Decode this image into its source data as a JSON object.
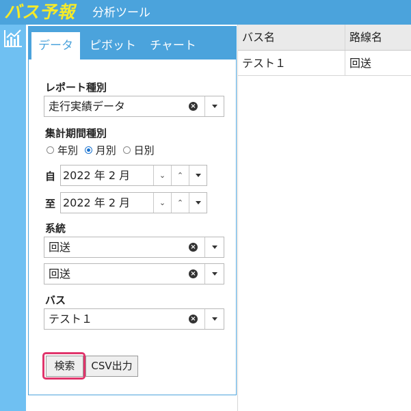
{
  "header": {
    "logo": "バス予報",
    "subtitle": "分析ツール"
  },
  "rail": {
    "icon": "chart-icon"
  },
  "tabs": [
    {
      "label": "データ",
      "active": true
    },
    {
      "label": "ピボット",
      "active": false
    },
    {
      "label": "チャート",
      "active": false
    }
  ],
  "report_type": {
    "label": "レポート種別",
    "value": "走行実績データ"
  },
  "period_type": {
    "label": "集計期間種別",
    "options": [
      {
        "label": "年別",
        "checked": false
      },
      {
        "label": "月別",
        "checked": true
      },
      {
        "label": "日別",
        "checked": false
      }
    ]
  },
  "from": {
    "label": "自",
    "value": "2022 年 2 月"
  },
  "to": {
    "label": "至",
    "value": "2022 年 2 月"
  },
  "route": {
    "label": "系統",
    "value1": "回送",
    "value2": "回送"
  },
  "bus": {
    "label": "バス",
    "value": "テスト１"
  },
  "buttons": {
    "search": "検索",
    "csv": "CSV出力"
  },
  "grid": {
    "columns": [
      "バス名",
      "路線名"
    ],
    "rows": [
      [
        "テスト１",
        "回送"
      ]
    ]
  },
  "colors": {
    "accent": "#4ba3dc",
    "rail": "#6fc0f2",
    "logo": "#f5ea2a",
    "highlight": "#e0346b"
  }
}
